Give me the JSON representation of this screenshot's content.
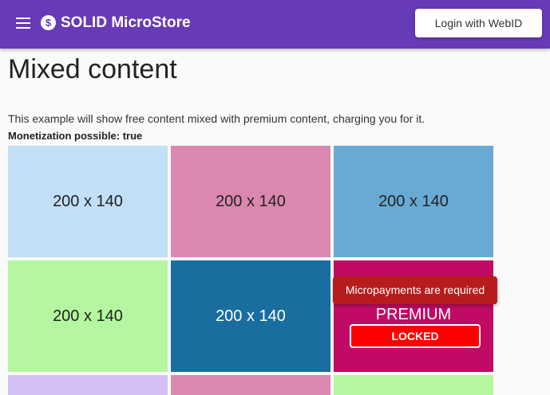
{
  "app": {
    "title": "SOLID MicroStore",
    "logo_symbol": "$",
    "login_label": "Login with WebID",
    "menu_icon": "hamburger-menu-icon",
    "brand_color": "#673ab7"
  },
  "main": {
    "title": "Mixed content",
    "intro": "This example will show free content mixed with premium content, charging you for it.",
    "monetization": "Monetization possible: true"
  },
  "tiles": [
    {
      "label": "200 x 140",
      "color": "#c2dff6"
    },
    {
      "label": "200 x 140",
      "color": "#db88b1"
    },
    {
      "label": "200 x 140",
      "color": "#68aad4"
    },
    {
      "label": "200 x 140",
      "color": "#b4f7a0"
    },
    {
      "label": "200 x 140",
      "color": "#1a6d9f"
    },
    {
      "color": "#c10a63",
      "premium_label": "PREMIUM",
      "locked_label": "LOCKED"
    },
    {
      "color": "#d4c0f5"
    },
    {
      "color": "#db88b1"
    },
    {
      "color": "#b4f7a0"
    }
  ],
  "tooltip": {
    "text": "Micropayments are required",
    "color": "#b71c1c"
  }
}
